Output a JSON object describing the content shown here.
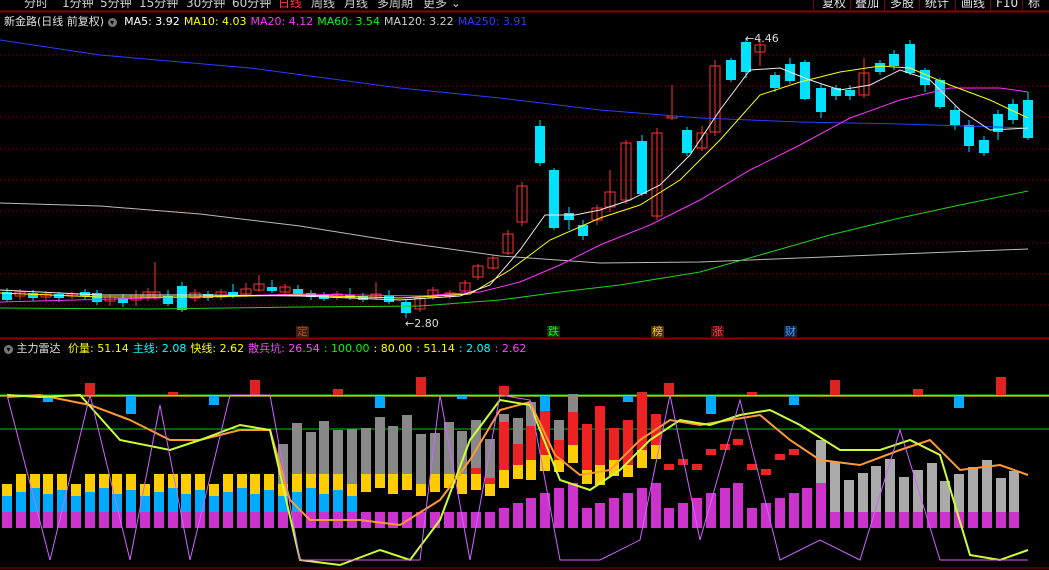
{
  "toolbar": {
    "tabs": [
      "分时",
      "1分钟",
      "5分钟",
      "15分钟",
      "30分钟",
      "60分钟",
      "日线",
      "周线",
      "月线",
      "多周期",
      "更多"
    ],
    "active_tab": "日线",
    "right_buttons": [
      "复权",
      "叠加",
      "多股",
      "统计",
      "画线",
      "F10",
      "标记"
    ]
  },
  "main_legend": {
    "stock": "新金路(日线 前复权)",
    "ma": [
      {
        "label": "MA5: 3.92",
        "color": "#ffffff"
      },
      {
        "label": "MA10: 4.03",
        "color": "#ffff00"
      },
      {
        "label": "MA20: 4.12",
        "color": "#ff33ff"
      },
      {
        "label": "MA60: 3.54",
        "color": "#00ff00"
      },
      {
        "label": "MA120: 3.22",
        "color": "#cccccc"
      },
      {
        "label": "MA250: 3.91",
        "color": "#2a3cff"
      }
    ]
  },
  "price_labels": {
    "high": "4.46",
    "low": "2.80"
  },
  "signal_tags": [
    {
      "text": "定",
      "color": "#b05020",
      "bg": "#402010"
    },
    {
      "text": "跌",
      "color": "#00ff00",
      "bg": "#103010"
    },
    {
      "text": "榜",
      "color": "#ffcc00",
      "bg": "#403000"
    },
    {
      "text": "涨",
      "color": "#ff4040",
      "bg": "#401010"
    },
    {
      "text": "财",
      "color": "#40a0ff",
      "bg": "#102040"
    }
  ],
  "sub_legend": {
    "name": "主力雷达",
    "items": [
      {
        "label": "价量: 51.14",
        "color": "#ffff00"
      },
      {
        "label": "主线: 2.08",
        "color": "#00ffff"
      },
      {
        "label": "快线: 2.62",
        "color": "#ffff00"
      },
      {
        "label": "散兵坑: 26.54",
        "color": "#ff44ff"
      },
      {
        "label": ": 100.00",
        "color": "#00ff00"
      },
      {
        "label": ": 80.00",
        "color": "#ffff00"
      },
      {
        "label": ": 51.14",
        "color": "#ffff00"
      },
      {
        "label": ": 2.08",
        "color": "#00ffff"
      },
      {
        "label": ": 2.62",
        "color": "#ff44ff"
      }
    ]
  },
  "colors": {
    "up": "#ff3232",
    "down": "#00e0ff",
    "grid": "#8b0000"
  }
}
